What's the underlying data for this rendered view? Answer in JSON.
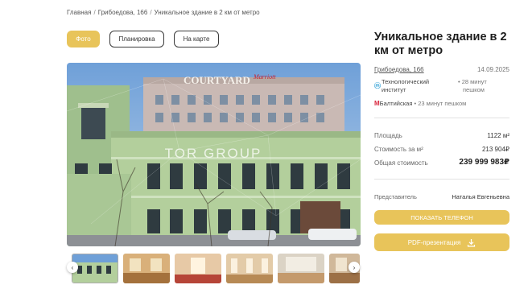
{
  "breadcrumb": {
    "items": [
      "Главная",
      "Грибоедова, 166",
      "Уникальное здание в 2 км от метро"
    ],
    "separator": "/"
  },
  "tabs": [
    {
      "label": "Фото",
      "active": true
    },
    {
      "label": "Планировка",
      "active": false
    },
    {
      "label": "На карте",
      "active": false
    }
  ],
  "gallery": {
    "watermark": "TOR GROUP",
    "sign_text": "COURTYARD",
    "sign_brand": "Marriott",
    "prev_icon": "chevron-left-icon",
    "next_icon": "chevron-right-icon"
  },
  "listing": {
    "title": "Уникальное здание в 2 км от метро",
    "address": "Грибоедова, 166",
    "date": "14.09.2025",
    "metro": [
      {
        "station_line1": "Технологический",
        "station_line2": "институт",
        "walk_line1": "28 минут",
        "walk_line2": "пешком",
        "color": "#3aa6d9"
      },
      {
        "station": "Балтийская",
        "walk": "23 минут пешком",
        "color": "#d9253c"
      }
    ],
    "area_label": "Площадь",
    "area_value": "1122 м²",
    "price_per_m2_label": "Стоимость за м²",
    "price_per_m2_value": "213 904₽",
    "total_label": "Общая стоимость",
    "total_value": "239 999 983₽",
    "agent_label": "Представитель",
    "agent_name": "Наталья Евгеньевна",
    "phone_button": "ПОКАЗАТЬ ТЕЛЕФОН",
    "pdf_button": "PDF-презентация",
    "pdf_icon": "download-icon"
  },
  "colors": {
    "accent": "#e8c45a",
    "text": "#2b2b2b"
  }
}
